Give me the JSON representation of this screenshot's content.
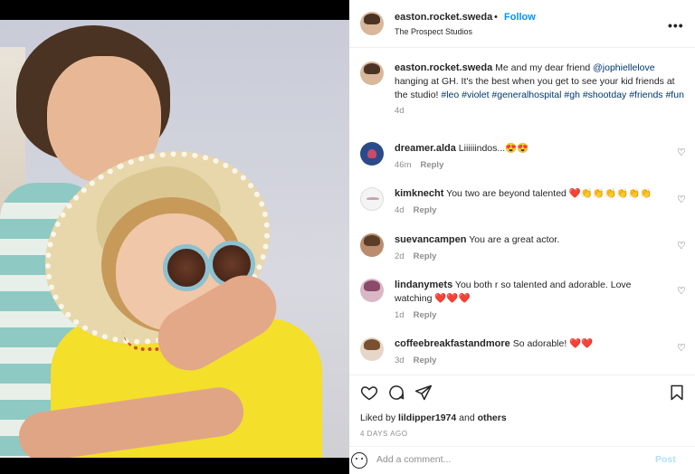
{
  "post": {
    "author": "easton.rocket.sweda",
    "follow_label": "Follow",
    "location": "The Prospect Studios",
    "more_icon": "more-options-icon"
  },
  "caption": {
    "author": "easton.rocket.sweda",
    "text_before": "Me and my dear friend",
    "mention": "@jophiellelove",
    "text_after": "hanging at GH. It's the best when you get to see your kid friends at the studio!",
    "hashtags": "#leo #violet #generalhospital #gh #shootday #friends #fun",
    "time": "4d"
  },
  "comments": [
    {
      "user": "dreamer.alda",
      "text": "Liiiiiindos...😍😍",
      "time": "46m",
      "reply": "Reply"
    },
    {
      "user": "kimknecht",
      "text": "You two are beyond talented ❤️👏👏👏👏👏👏",
      "time": "4d",
      "reply": "Reply"
    },
    {
      "user": "suevancampen",
      "text": "You are a great actor.",
      "time": "2d",
      "reply": "Reply"
    },
    {
      "user": "lindanymets",
      "text": "You both r so talented and adorable. Love watching ❤️❤️❤️",
      "time": "1d",
      "reply": "Reply"
    },
    {
      "user": "coffeebreakfastandmore",
      "text": "So adorable! ❤️❤️",
      "time": "3d",
      "reply": "Reply"
    }
  ],
  "likes": {
    "prefix": "Liked by",
    "user": "lildipper1974",
    "middle": "and",
    "others": "others"
  },
  "date": "4 DAYS AGO",
  "add_comment": {
    "placeholder": "Add a comment...",
    "post_label": "Post"
  }
}
